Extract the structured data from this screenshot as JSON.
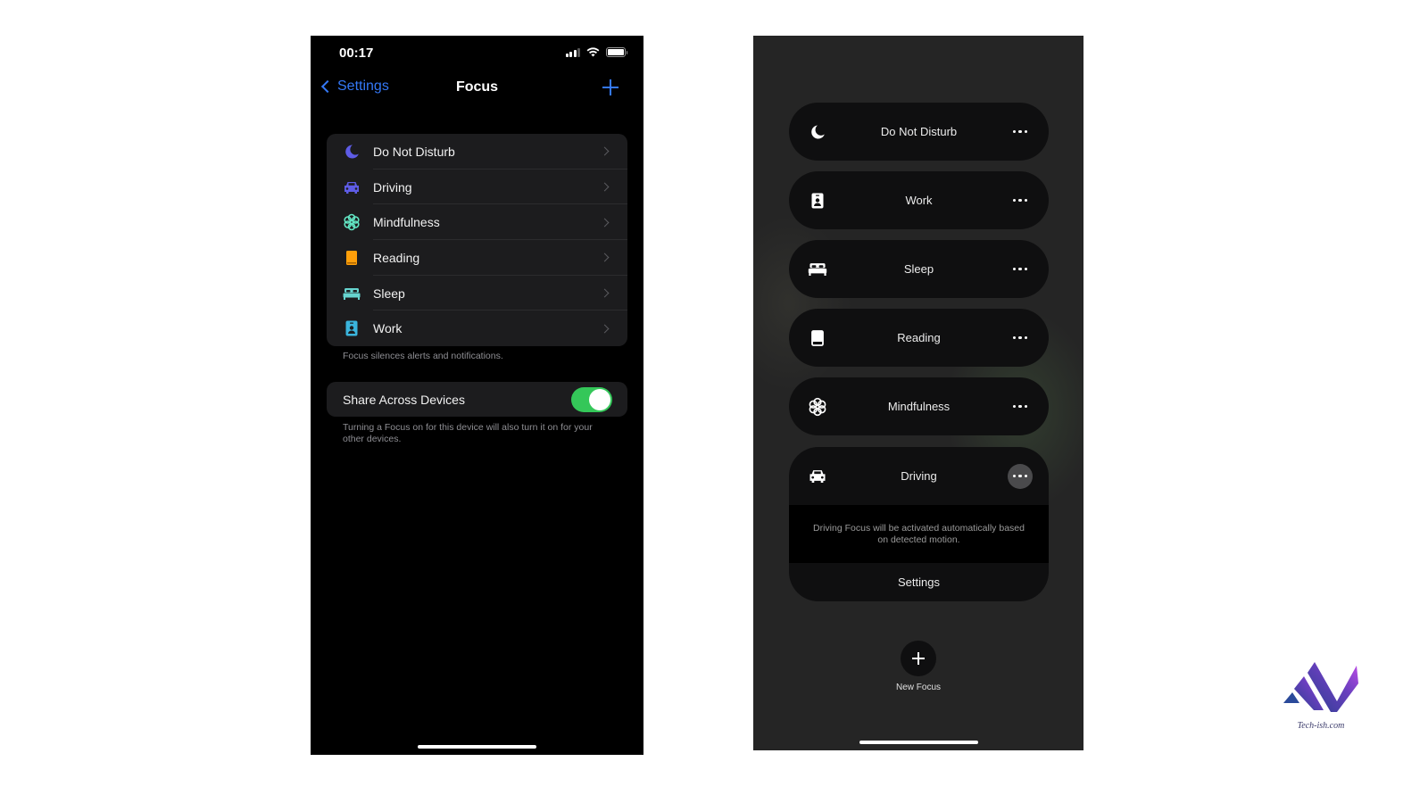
{
  "left_phone": {
    "status_bar": {
      "time": "00:17",
      "icons": [
        "cellular-signal-icon",
        "wifi-icon",
        "battery-icon"
      ]
    },
    "nav": {
      "back_label": "Settings",
      "title": "Focus",
      "add_icon": "plus-icon"
    },
    "focus_items": [
      {
        "label": "Do Not Disturb",
        "icon": "moon-icon",
        "color": "#5e5ce6"
      },
      {
        "label": "Driving",
        "icon": "car-icon",
        "color": "#5e5ce6"
      },
      {
        "label": "Mindfulness",
        "icon": "flower-icon",
        "color": "#63e6c4"
      },
      {
        "label": "Reading",
        "icon": "book-icon",
        "color": "#ff9f0a"
      },
      {
        "label": "Sleep",
        "icon": "bed-icon",
        "color": "#66d4cf"
      },
      {
        "label": "Work",
        "icon": "id-badge-icon",
        "color": "#3ab4dc"
      }
    ],
    "list_footnote": "Focus silences alerts and notifications.",
    "share": {
      "label": "Share Across Devices",
      "enabled": true,
      "toggle_color": "#34c759"
    },
    "share_footnote": "Turning a Focus on for this device will also turn it on for your other devices."
  },
  "right_phone": {
    "focus_pills": [
      {
        "label": "Do Not Disturb",
        "icon": "moon-icon"
      },
      {
        "label": "Work",
        "icon": "id-badge-icon"
      },
      {
        "label": "Sleep",
        "icon": "bed-icon"
      },
      {
        "label": "Reading",
        "icon": "book-icon"
      },
      {
        "label": "Mindfulness",
        "icon": "flower-icon"
      }
    ],
    "expanded": {
      "label": "Driving",
      "icon": "car-icon",
      "description": "Driving Focus will be activated automatically based on detected motion.",
      "settings_label": "Settings"
    },
    "new_focus_label": "New Focus"
  },
  "watermark": {
    "text": "Tech-ish.com"
  }
}
